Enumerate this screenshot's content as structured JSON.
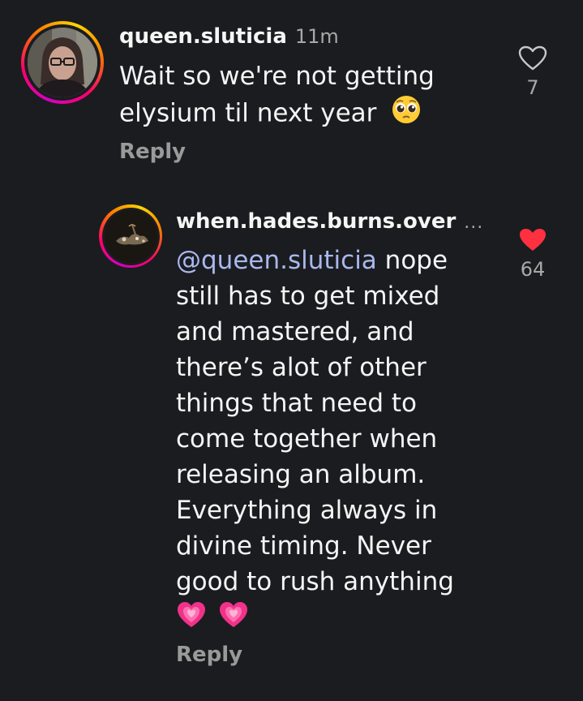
{
  "comments": [
    {
      "username": "queen.sluticia",
      "timestamp": "11m",
      "lines": [
        "Wait so we're not getting",
        "elysium til next year"
      ],
      "reply_label": "Reply",
      "like_count": "7",
      "liked": false,
      "emoji": "pleading-face"
    },
    {
      "username": "when.hades.burns.over",
      "more": "...",
      "mention": "@queen.sluticia",
      "first_line_rest": " nope",
      "lines": [
        "still has to get mixed",
        "and mastered, and",
        "there’s alot of other",
        "things that need to",
        "come together when",
        "releasing an album.",
        "Everything always in",
        "divine timing. Never",
        "good to rush anything"
      ],
      "emojis": [
        "heartbeat-heart",
        "heartbeat-heart"
      ],
      "reply_label": "Reply",
      "like_count": "64",
      "liked": true
    }
  ],
  "colors": {
    "background": "#1b1c1f",
    "mention": "#a9b8f0",
    "like_active": "#ff3040",
    "secondary_text": "#a8a8a8"
  }
}
